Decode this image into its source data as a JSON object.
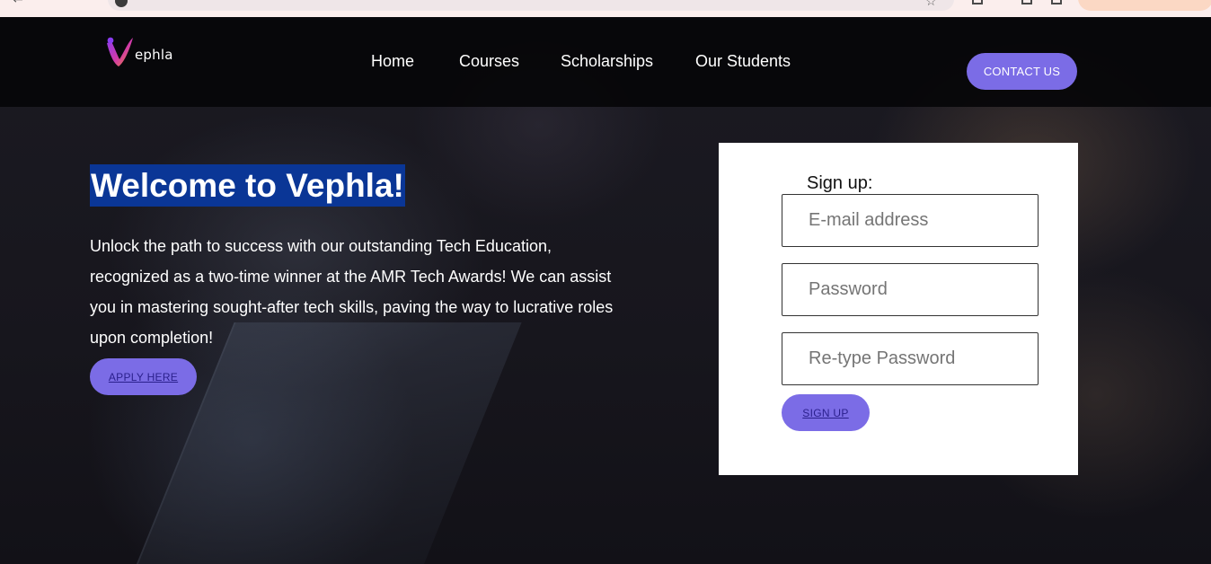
{
  "brand": {
    "name": "ephla",
    "accent": "#7b6ce6",
    "highlight": "#0a3696"
  },
  "nav": {
    "links": [
      {
        "label": "Home"
      },
      {
        "label": "Courses"
      },
      {
        "label": "Scholarships"
      },
      {
        "label": "Our Students"
      }
    ],
    "contact_label": "CONTACT US"
  },
  "hero": {
    "title": "Welcome to Vephla!",
    "description": "Unlock the path to success with our outstanding Tech Education, recognized as a two-time winner at the AMR Tech Awards! We can assist you in mastering sought-after tech skills, paving the way to lucrative roles upon completion!",
    "apply_label": "APPLY HERE"
  },
  "signup": {
    "title": "Sign up:",
    "email_placeholder": "E-mail address",
    "password_placeholder": "Password",
    "retype_placeholder": "Re-type Password",
    "submit_label": "SIGN UP"
  },
  "icons": [
    "back-icon",
    "site-info-icon",
    "bookmark-star-icon",
    "extension-icon",
    "profile-pill",
    "vephla-logo-mark"
  ]
}
